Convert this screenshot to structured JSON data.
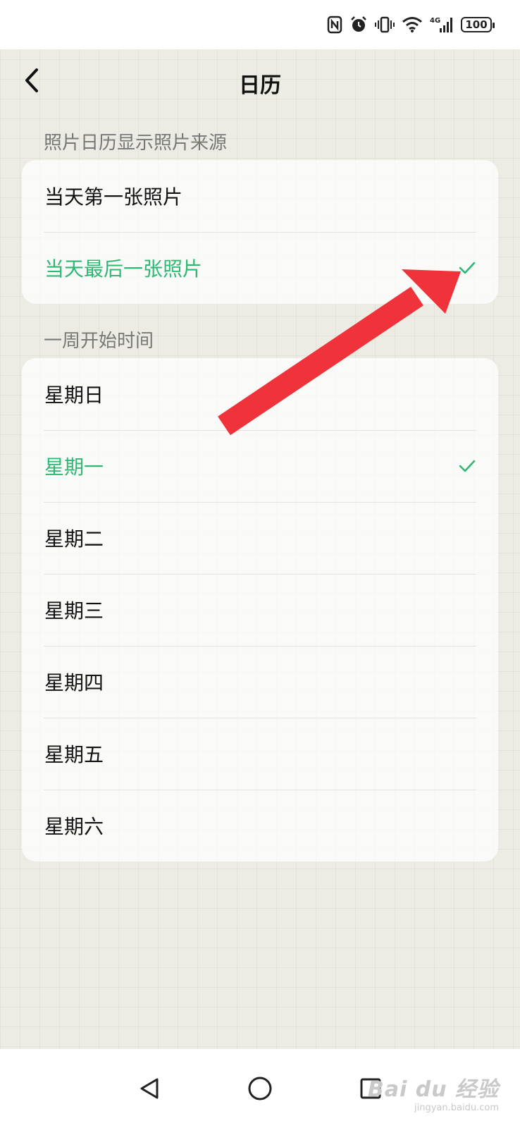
{
  "status_bar": {
    "battery_level": "100",
    "icons": [
      "nfc-icon",
      "alarm-icon",
      "vibrate-icon",
      "wifi-icon",
      "signal-4g-icon",
      "battery-icon"
    ],
    "network_label": "4G"
  },
  "header": {
    "title": "日历",
    "back_icon": "chevron-left-icon"
  },
  "photo_source": {
    "section_title": "照片日历显示照片来源",
    "options": [
      {
        "label": "当天第一张照片",
        "selected": false
      },
      {
        "label": "当天最后一张照片",
        "selected": true
      }
    ]
  },
  "week_start": {
    "section_title": "一周开始时间",
    "options": [
      {
        "label": "星期日",
        "selected": false
      },
      {
        "label": "星期一",
        "selected": true
      },
      {
        "label": "星期二",
        "selected": false
      },
      {
        "label": "星期三",
        "selected": false
      },
      {
        "label": "星期四",
        "selected": false
      },
      {
        "label": "星期五",
        "selected": false
      },
      {
        "label": "星期六",
        "selected": false
      }
    ]
  },
  "colors": {
    "accent": "#2fb872",
    "annotation_arrow": "#f0323a",
    "background": "#ecece4"
  },
  "nav_bar": {
    "icons": [
      "back-triangle-icon",
      "home-circle-icon",
      "recents-square-icon"
    ]
  },
  "watermark": {
    "main": "Bai du 经验",
    "sub": "jingyan.baidu.com"
  }
}
